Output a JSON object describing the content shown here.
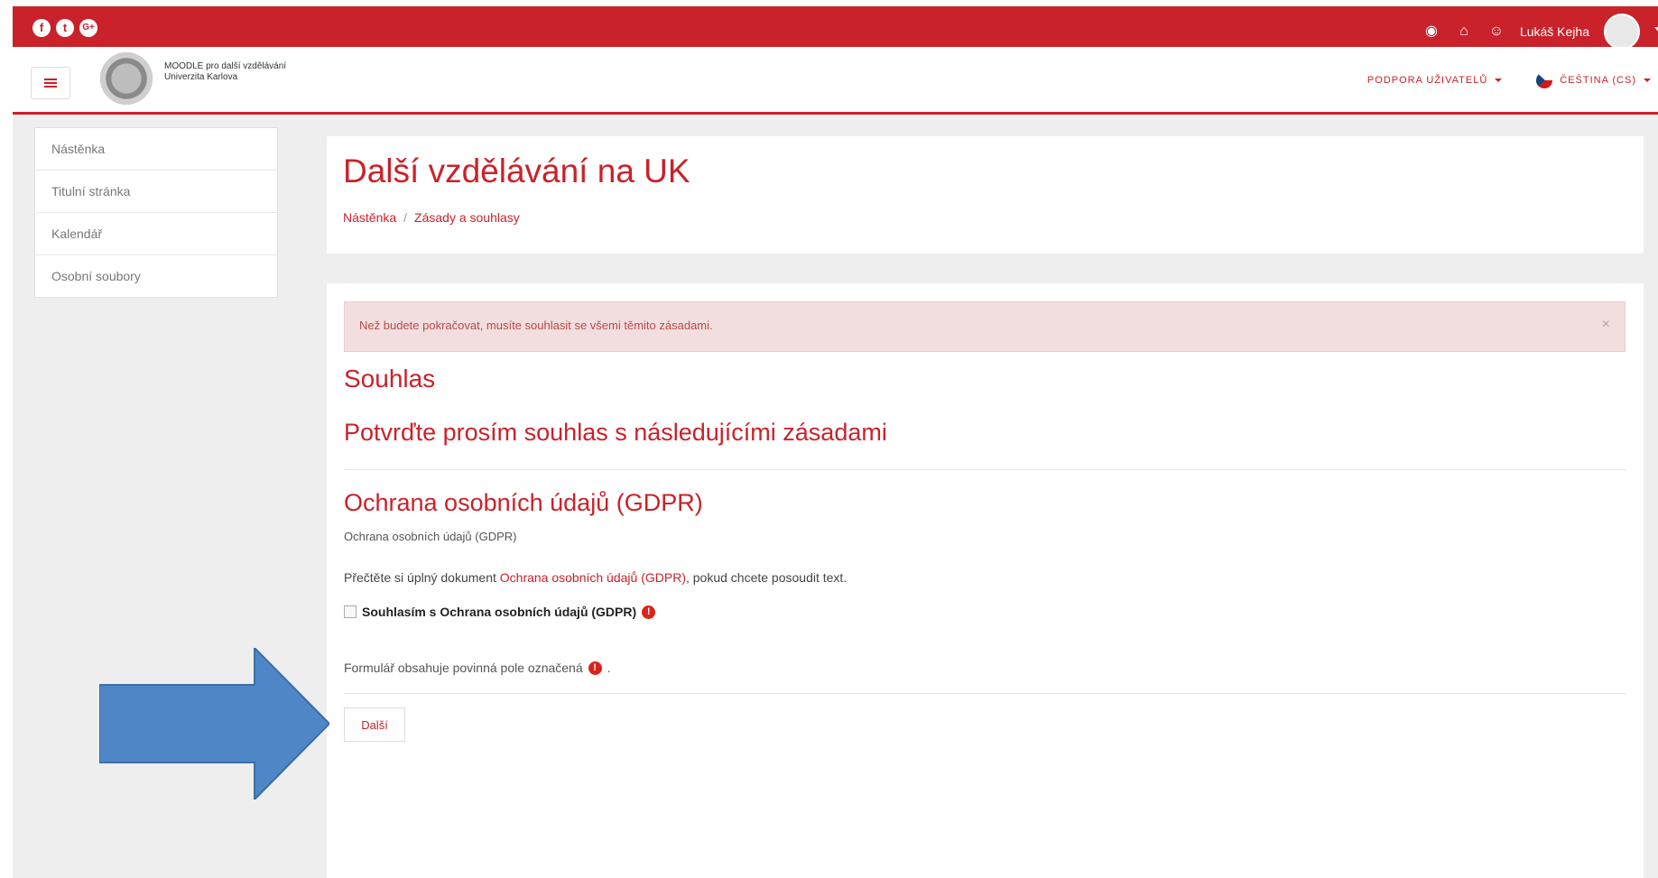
{
  "topbar": {
    "social": [
      "f",
      "t",
      "G+"
    ],
    "icons": [
      "dashboard-icon",
      "home-icon",
      "users-icon"
    ],
    "username": "Lukáš Kejha"
  },
  "header": {
    "site_name_line1": "MOODLE pro další vzdělávání",
    "site_name_line2": "Univerzita Karlova",
    "support_menu": "PODPORA UŽIVATELŮ",
    "language_menu": "ČEŠTINA (CS)"
  },
  "sidebar": {
    "items": [
      {
        "label": "Nástěnka"
      },
      {
        "label": "Titulní stránka"
      },
      {
        "label": "Kalendář"
      },
      {
        "label": "Osobní soubory"
      }
    ]
  },
  "page": {
    "title": "Další vzdělávání na UK",
    "breadcrumb": [
      "Nástěnka",
      "Zásady a souhlasy"
    ],
    "breadcrumb_sep": "/"
  },
  "main": {
    "alert_text": "Než budete pokračovat, musíte souhlasit se všemi těmito zásadami.",
    "alert_close": "×",
    "heading": "Souhlas",
    "subheading": "Potvrďte prosím souhlas s následujícími zásadami",
    "policy_title": "Ochrana osobních údajů (GDPR)",
    "policy_subtitle": "Ochrana osobních údajů (GDPR)",
    "read_prefix": "Přečtěte si úplný dokument",
    "read_link": "Ochrana osobních údajů (GDPR)",
    "read_suffix": ", pokud chcete posoudit text.",
    "consent_label": "Souhlasím s Ochrana osobních údajů (GDPR)",
    "required_glyph": "!",
    "form_note": "Formulář obsahuje povinná pole označená",
    "form_note_end": ".",
    "next_button": "Další"
  },
  "colors": {
    "brand_red": "#c9222a",
    "arrow_blue": "#4f86c6"
  }
}
